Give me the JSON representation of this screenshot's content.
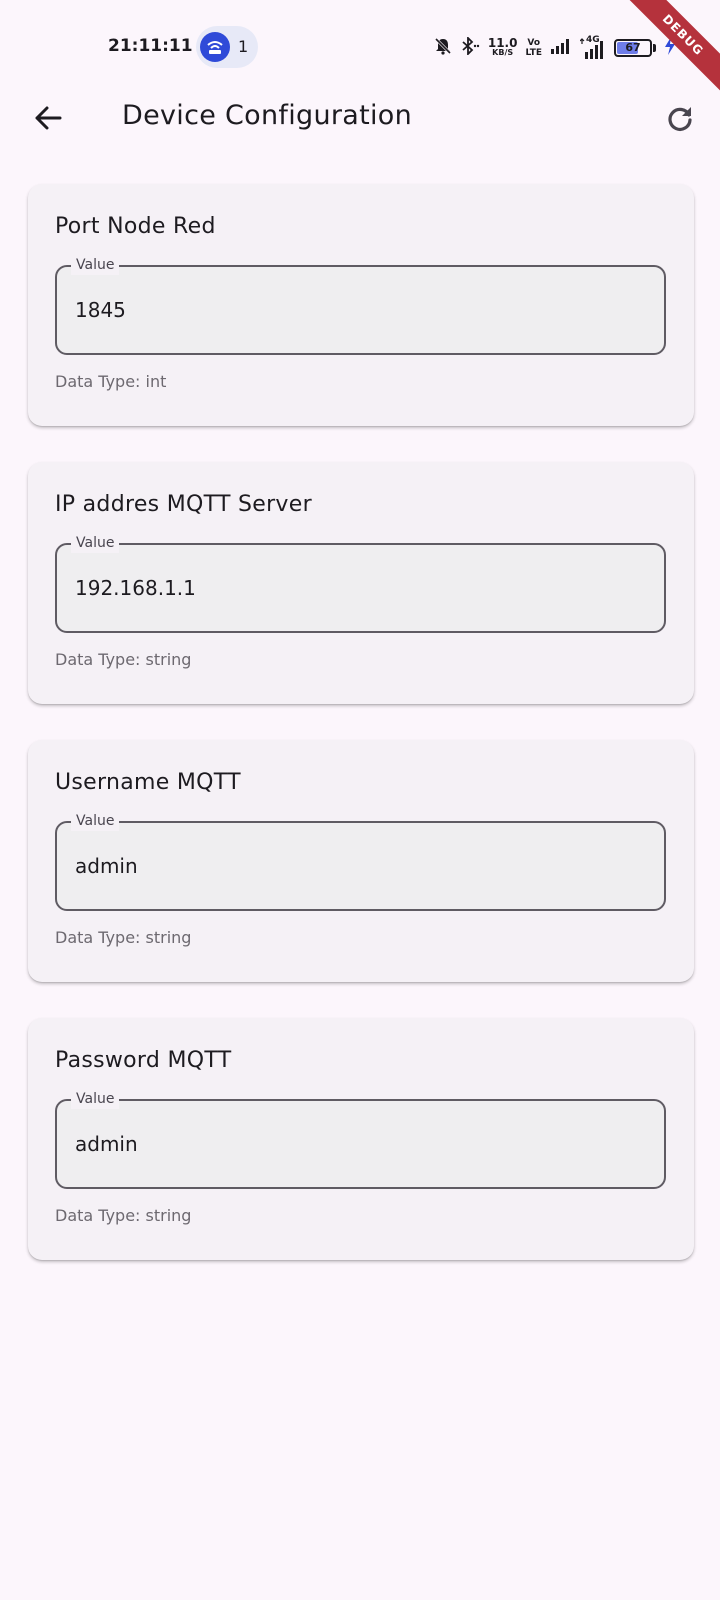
{
  "status_bar": {
    "time": "21:11:11",
    "hotspot_count": "1",
    "net_speed_value": "11.0",
    "net_speed_unit": "KB/S",
    "volte_top": "Vo",
    "volte_bottom": "LTE",
    "network_label": "4G",
    "battery_level": "67",
    "battery_fraction": 0.67,
    "debug_label": "DEBUG",
    "icons": [
      "hotspot-icon",
      "mute-bell-icon",
      "bluetooth-icon",
      "signal-icon",
      "battery-icon",
      "charging-icon"
    ]
  },
  "app_bar": {
    "title": "Device Configuration",
    "back_icon": "arrow-back-icon",
    "refresh_icon": "refresh-icon"
  },
  "configs": [
    {
      "title": "Port Node Red",
      "field_label": "Value",
      "value": "1845",
      "data_type": "Data Type: int"
    },
    {
      "title": "IP addres MQTT Server",
      "field_label": "Value",
      "value": "192.168.1.1",
      "data_type": "Data Type: string"
    },
    {
      "title": "Username MQTT",
      "field_label": "Value",
      "value": "admin",
      "data_type": "Data Type: string"
    },
    {
      "title": "Password MQTT",
      "field_label": "Value",
      "value": "admin",
      "data_type": "Data Type: string"
    }
  ],
  "colors": {
    "background": "#fcf6fc",
    "card": "#f5f1f6",
    "field_border": "#5f5b63",
    "accent_blue": "#2f4ad8",
    "debug_red": "#b5323c"
  }
}
